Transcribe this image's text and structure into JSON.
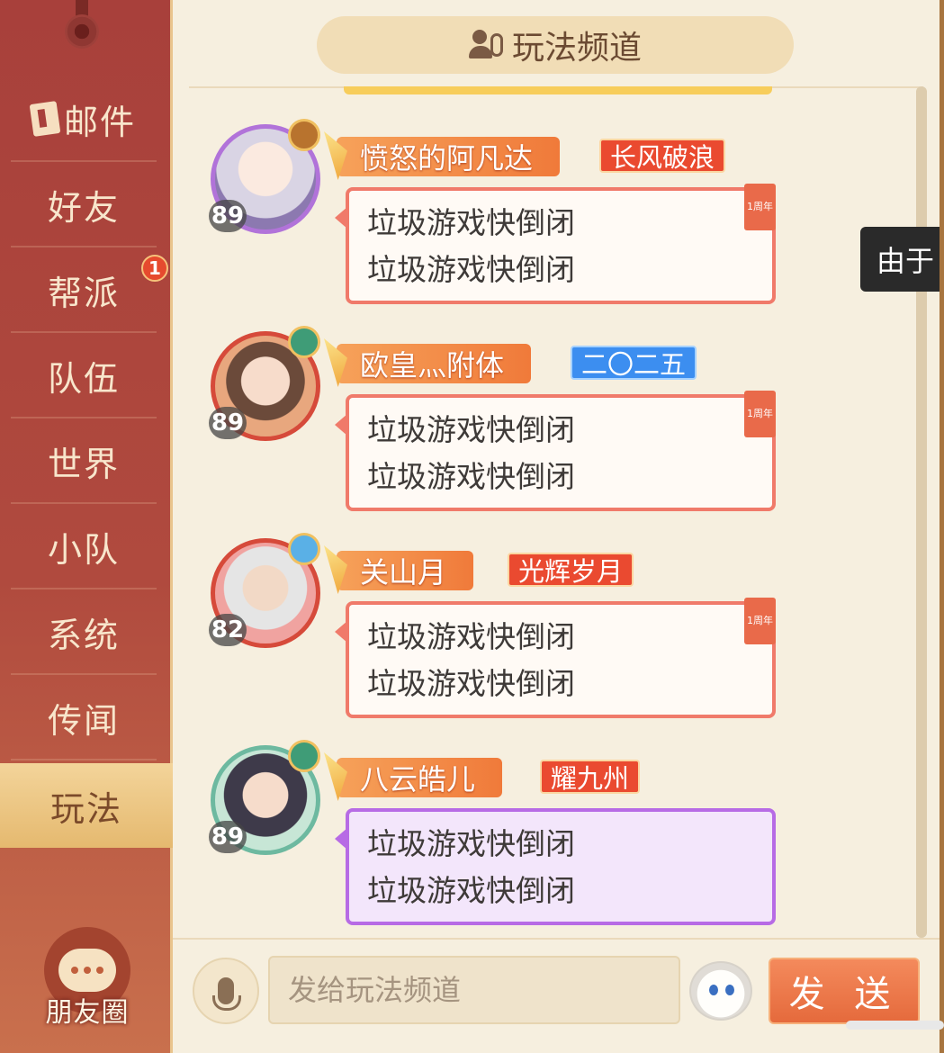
{
  "sidebar": {
    "items": [
      {
        "label": "邮件",
        "icon": "mail-icon"
      },
      {
        "label": "好友"
      },
      {
        "label": "帮派",
        "badge": "1"
      },
      {
        "label": "队伍"
      },
      {
        "label": "世界"
      },
      {
        "label": "小队"
      },
      {
        "label": "系统"
      },
      {
        "label": "传闻"
      },
      {
        "label": "玩法",
        "active": true
      }
    ],
    "moments_label": "朋友圈"
  },
  "header": {
    "title": "玩法频道",
    "icon": "people-icon"
  },
  "messages": [
    {
      "level": "89",
      "name": "愤怒的阿凡达",
      "title": "长风破浪",
      "title_color": "red",
      "lines": [
        "垃圾游戏快倒闭",
        "垃圾游戏快倒闭"
      ],
      "bubble_tag": "1周年"
    },
    {
      "level": "89",
      "name": "欧皇灬附体",
      "title": "二〇二五",
      "title_color": "blue",
      "lines": [
        "垃圾游戏快倒闭",
        "垃圾游戏快倒闭"
      ],
      "bubble_tag": "1周年"
    },
    {
      "level": "82",
      "name": "关山月",
      "title": "光辉岁月",
      "title_color": "red",
      "lines": [
        "垃圾游戏快倒闭",
        "垃圾游戏快倒闭"
      ],
      "bubble_tag": "1周年"
    },
    {
      "level": "89",
      "name": "八云皓儿",
      "title": "耀九州",
      "title_color": "red",
      "lines": [
        "垃圾游戏快倒闭",
        "垃圾游戏快倒闭"
      ],
      "bubble_tag": ""
    }
  ],
  "input": {
    "placeholder": "发给玩法频道",
    "send_label": "发 送"
  },
  "tooltip": {
    "text": "由于"
  },
  "colors": {
    "accent": "#e56a3c",
    "sidebar": "#a8403b",
    "active_tab": "#f3d49a"
  }
}
